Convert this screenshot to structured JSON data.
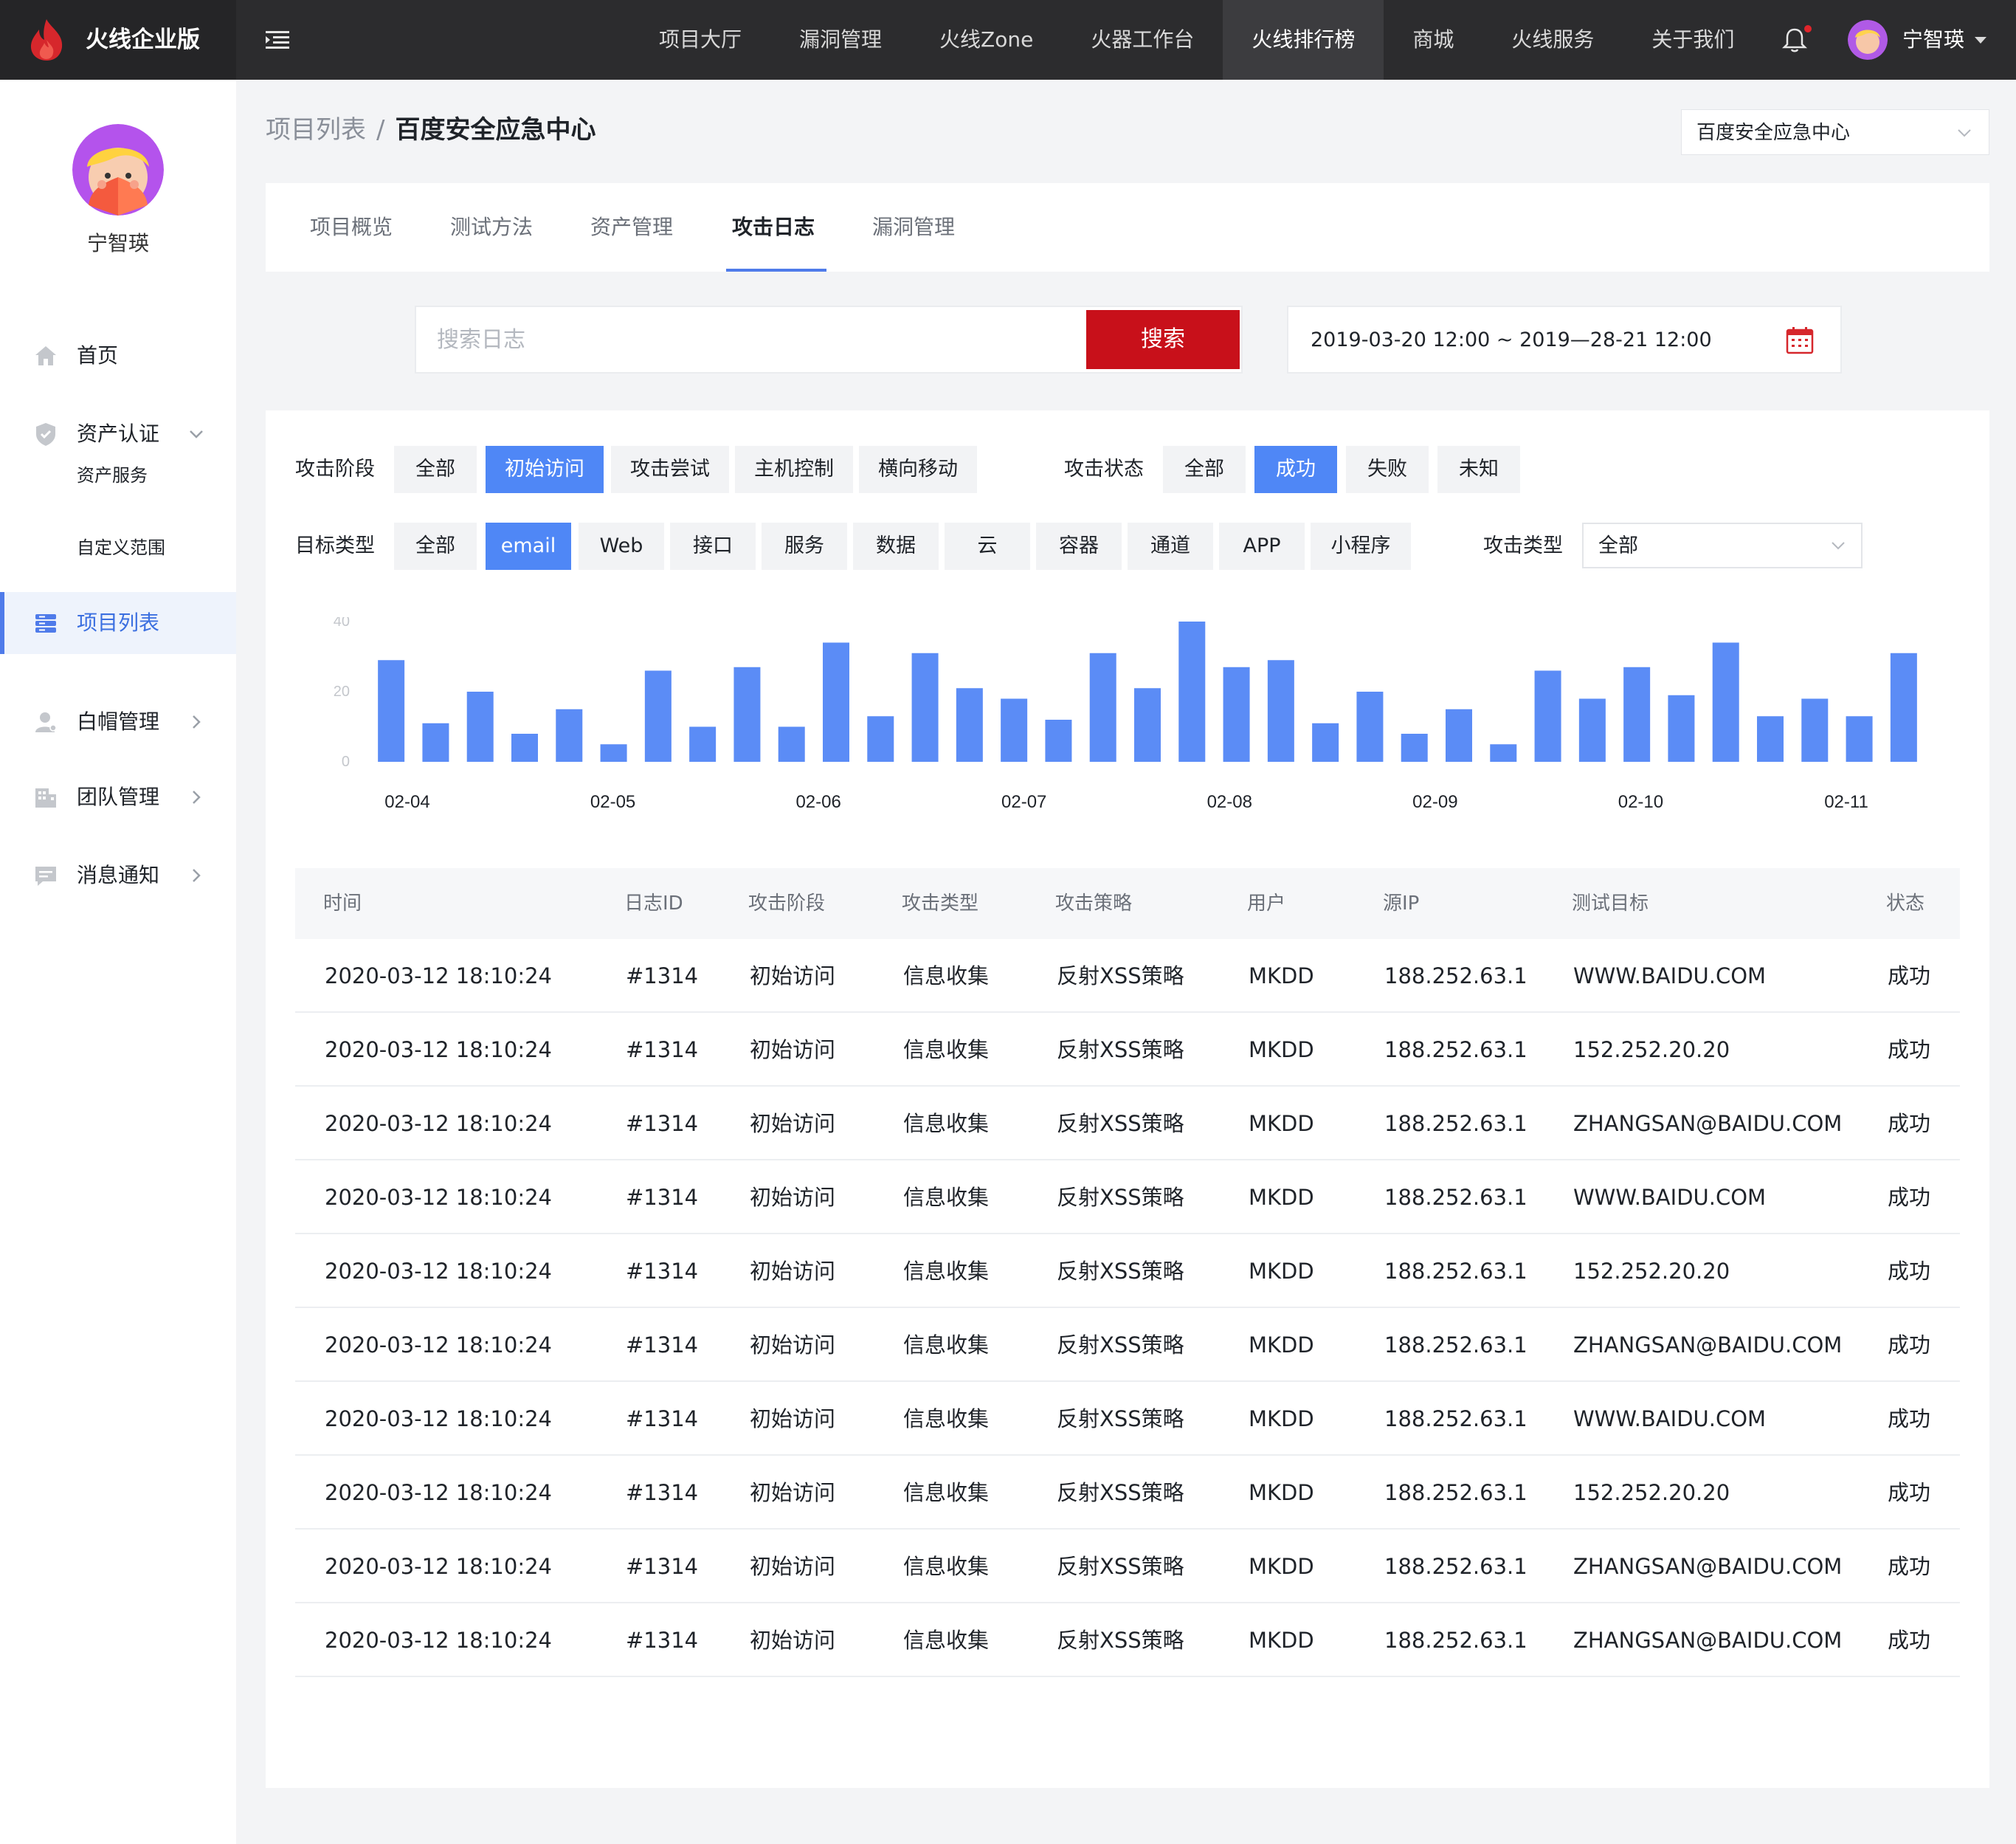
{
  "brand": {
    "name": "火线企业版"
  },
  "nav": {
    "items": [
      "项目大厅",
      "漏洞管理",
      "火线Zone",
      "火器工作台",
      "火线排行榜",
      "商城",
      "火线服务",
      "关于我们"
    ],
    "active_index": 4
  },
  "user": {
    "name": "宁智瑛"
  },
  "sidebar": {
    "username": "宁智瑛",
    "home": "首页",
    "asset_cert": "资产认证",
    "asset_service": "资产服务",
    "custom_scope": "自定义范围",
    "project_list": "项目列表",
    "whitehat": "白帽管理",
    "team": "团队管理",
    "notify": "消息通知"
  },
  "breadcrumb": {
    "parent": "项目列表",
    "separator": "/",
    "current": "百度安全应急中心"
  },
  "project_select": {
    "value": "百度安全应急中心"
  },
  "tabs": [
    "项目概览",
    "测试方法",
    "资产管理",
    "攻击日志",
    "漏洞管理"
  ],
  "active_tab": 3,
  "search": {
    "placeholder": "搜索日志",
    "button": "搜索"
  },
  "date_range": {
    "value": "2019-03-20 12:00 ~ 2019—28-21 12:00"
  },
  "filters": {
    "stage_label": "攻击阶段",
    "stages": [
      "全部",
      "初始访问",
      "攻击尝试",
      "主机控制",
      "横向移动"
    ],
    "stage_active": 1,
    "status_label": "攻击状态",
    "statuses": [
      "全部",
      "成功",
      "失败",
      "未知"
    ],
    "status_active": 1,
    "target_label": "目标类型",
    "targets": [
      "全部",
      "email",
      "Web",
      "接口",
      "服务",
      "数据",
      "云",
      "容器",
      "通道",
      "APP",
      "小程序"
    ],
    "target_active": 1,
    "attack_type_label": "攻击类型",
    "attack_type_value": "全部"
  },
  "colors": {
    "accent": "#4f87f6",
    "brand_red": "#c8101a",
    "bar": "#5b8cf6"
  },
  "chart_data": {
    "type": "bar",
    "ylim": [
      0,
      40
    ],
    "yticks": [
      0,
      20,
      40
    ],
    "x_tick_labels": [
      "02-04",
      "02-05",
      "02-06",
      "02-07",
      "02-08",
      "02-09",
      "02-10",
      "02-11"
    ],
    "values": [
      29,
      11,
      20,
      8,
      15,
      5,
      26,
      10,
      27,
      10,
      34,
      13,
      31,
      21,
      18,
      12,
      31,
      21,
      40,
      27,
      29,
      11,
      20,
      8,
      15,
      5,
      26,
      18,
      27,
      19,
      34,
      13,
      18,
      13,
      31
    ]
  },
  "table": {
    "columns": [
      "时间",
      "日志ID",
      "攻击阶段",
      "攻击类型",
      "攻击策略",
      "用户",
      "源IP",
      "测试目标",
      "状态"
    ],
    "rows": [
      [
        "2020-03-12 18:10:24",
        "#1314",
        "初始访问",
        "信息收集",
        "反射XSS策略",
        "MKDD",
        "188.252.63.1",
        "WWW.BAIDU.COM",
        "成功"
      ],
      [
        "2020-03-12 18:10:24",
        "#1314",
        "初始访问",
        "信息收集",
        "反射XSS策略",
        "MKDD",
        "188.252.63.1",
        "152.252.20.20",
        "成功"
      ],
      [
        "2020-03-12 18:10:24",
        "#1314",
        "初始访问",
        "信息收集",
        "反射XSS策略",
        "MKDD",
        "188.252.63.1",
        "ZHANGSAN@BAIDU.COM",
        "成功"
      ],
      [
        "2020-03-12 18:10:24",
        "#1314",
        "初始访问",
        "信息收集",
        "反射XSS策略",
        "MKDD",
        "188.252.63.1",
        "WWW.BAIDU.COM",
        "成功"
      ],
      [
        "2020-03-12 18:10:24",
        "#1314",
        "初始访问",
        "信息收集",
        "反射XSS策略",
        "MKDD",
        "188.252.63.1",
        "152.252.20.20",
        "成功"
      ],
      [
        "2020-03-12 18:10:24",
        "#1314",
        "初始访问",
        "信息收集",
        "反射XSS策略",
        "MKDD",
        "188.252.63.1",
        "ZHANGSAN@BAIDU.COM",
        "成功"
      ],
      [
        "2020-03-12 18:10:24",
        "#1314",
        "初始访问",
        "信息收集",
        "反射XSS策略",
        "MKDD",
        "188.252.63.1",
        "WWW.BAIDU.COM",
        "成功"
      ],
      [
        "2020-03-12 18:10:24",
        "#1314",
        "初始访问",
        "信息收集",
        "反射XSS策略",
        "MKDD",
        "188.252.63.1",
        "152.252.20.20",
        "成功"
      ],
      [
        "2020-03-12 18:10:24",
        "#1314",
        "初始访问",
        "信息收集",
        "反射XSS策略",
        "MKDD",
        "188.252.63.1",
        "ZHANGSAN@BAIDU.COM",
        "成功"
      ],
      [
        "2020-03-12 18:10:24",
        "#1314",
        "初始访问",
        "信息收集",
        "反射XSS策略",
        "MKDD",
        "188.252.63.1",
        "ZHANGSAN@BAIDU.COM",
        "成功"
      ]
    ]
  }
}
